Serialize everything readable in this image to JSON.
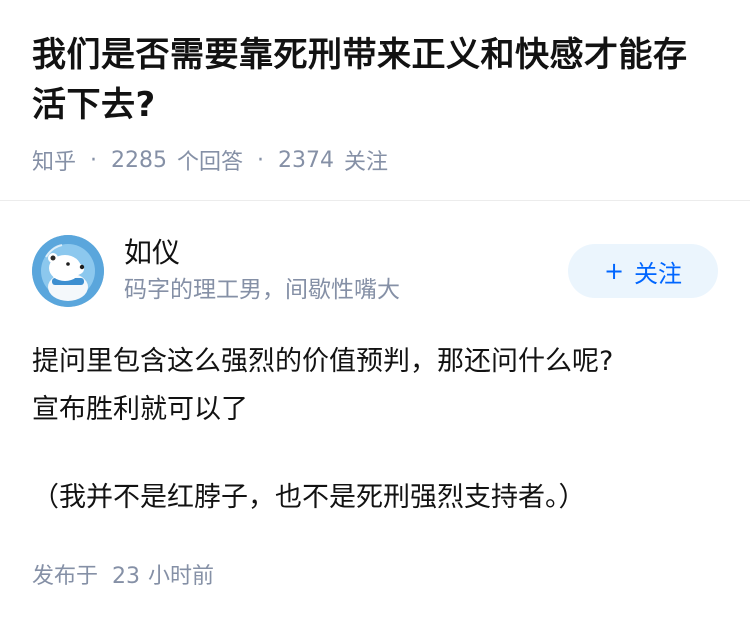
{
  "question": {
    "title": "我们是否需要靠死刑带来正义和快感才能存活下去?",
    "source": "知乎",
    "answer_count": "2285",
    "answer_label": "个回答",
    "follower_count": "2374",
    "follower_label": "关注"
  },
  "answer": {
    "author": {
      "name": "如仪",
      "bio": "码字的理工男，间歇性嘴大"
    },
    "follow_button": {
      "plus": "+",
      "label": "关注"
    },
    "paragraphs": [
      "提问里包含这么强烈的价值预判，那还问什么呢?",
      "宣布胜利就可以了",
      "（我并不是红脖子，也不是死刑强烈支持者。）"
    ],
    "time": {
      "prefix": "发布于",
      "count": "23",
      "unit": "小时前"
    }
  },
  "colors": {
    "meta_gray": "#8590a6",
    "brand_blue": "#0066ff",
    "follow_bg": "#ebf5fd"
  }
}
